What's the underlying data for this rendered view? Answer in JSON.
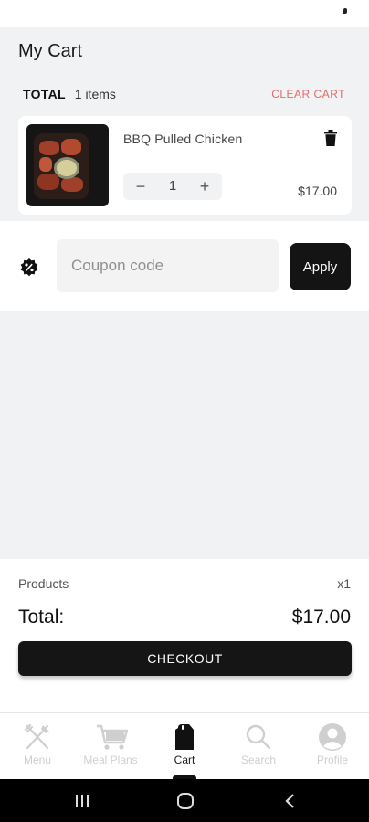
{
  "header": {
    "title": "My Cart"
  },
  "cart": {
    "total_label": "TOTAL",
    "item_count": "1 items",
    "clear_label": "CLEAR CART",
    "items": [
      {
        "name": "BBQ Pulled Chicken",
        "quantity": "1",
        "price": "$17.00",
        "minus": "−",
        "plus": "+"
      }
    ]
  },
  "coupon": {
    "placeholder": "Coupon code",
    "apply_label": "Apply"
  },
  "summary": {
    "products_label": "Products",
    "products_qty": "x1",
    "total_label": "Total:",
    "total_value": "$17.00",
    "checkout_label": "CHECKOUT"
  },
  "nav": {
    "items": [
      {
        "label": "Menu",
        "icon": "fork-knife-icon",
        "active": false
      },
      {
        "label": "Meal Plans",
        "icon": "shopping-cart-icon",
        "active": false
      },
      {
        "label": "Cart",
        "icon": "bag-icon",
        "active": true
      },
      {
        "label": "Search",
        "icon": "search-icon",
        "active": false
      },
      {
        "label": "Profile",
        "icon": "profile-icon",
        "active": false
      }
    ]
  },
  "colors": {
    "accent": "#141414",
    "clear_cart": "#e26b6b",
    "background": "#f1f2f4",
    "inactive_nav": "#cfcfcf"
  }
}
